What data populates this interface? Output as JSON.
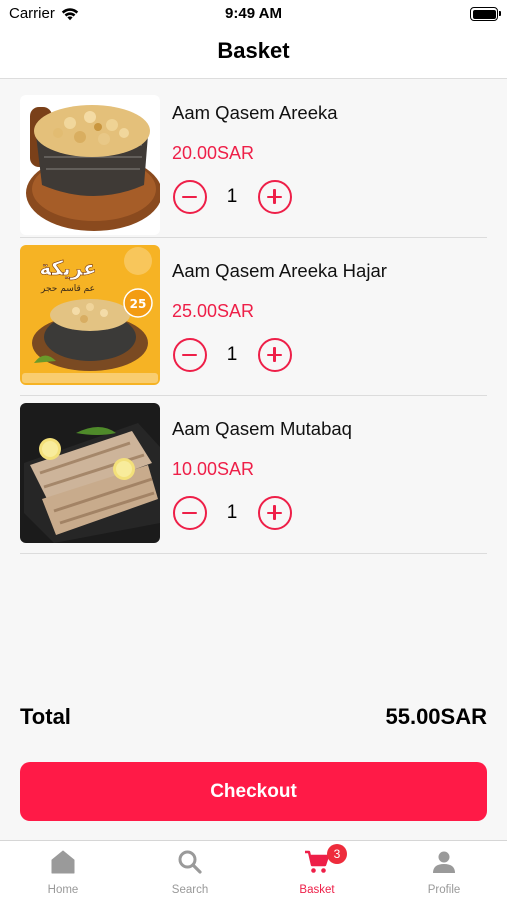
{
  "status_bar": {
    "carrier": "Carrier",
    "time": "9:49 AM"
  },
  "header": {
    "title": "Basket"
  },
  "basket": {
    "items": [
      {
        "name": "Aam Qasem Areeka",
        "price": "20.00SAR",
        "quantity": "1"
      },
      {
        "name": "Aam Qasem Areeka Hajar",
        "price": "25.00SAR",
        "quantity": "1",
        "image_text": "عريكة",
        "image_subtext": "عم قاسم حجر",
        "image_badge": "25"
      },
      {
        "name": "Aam Qasem Mutabaq",
        "price": "10.00SAR",
        "quantity": "1"
      }
    ]
  },
  "summary": {
    "total_label": "Total",
    "total_value": "55.00SAR"
  },
  "checkout": {
    "label": "Checkout"
  },
  "tab_bar": {
    "tabs": [
      {
        "label": "Home",
        "icon": "home-icon"
      },
      {
        "label": "Search",
        "icon": "search-icon"
      },
      {
        "label": "Basket",
        "icon": "cart-icon",
        "badge": "3",
        "active": true
      },
      {
        "label": "Profile",
        "icon": "person-icon"
      }
    ]
  },
  "colors": {
    "accent": "#ee1f48",
    "checkout_button": "#ff1a47",
    "inactive_tab": "#999999"
  }
}
